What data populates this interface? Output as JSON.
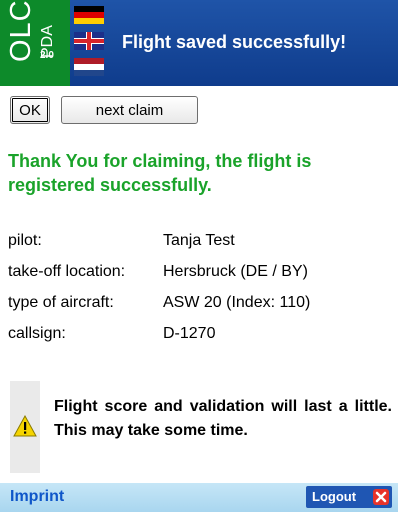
{
  "header": {
    "logo_text": "OLC",
    "logo_sub": "PDA",
    "logo_version": "2.0",
    "title": "Flight saved successfully!",
    "flags": [
      "germany-flag",
      "uk-flag",
      "netherlands-flag"
    ]
  },
  "buttons": {
    "ok_label": "OK",
    "next_claim_label": "next claim"
  },
  "message": "Thank You for claiming, the flight is registered successfully.",
  "details": [
    {
      "label": "pilot:",
      "value": "Tanja Test"
    },
    {
      "label": "take-off location:",
      "value": "Hersbruck (DE / BY)"
    },
    {
      "label": "type of aircraft:",
      "value": "ASW 20 (Index: 110)"
    },
    {
      "label": "callsign:",
      "value": "D-1270"
    }
  ],
  "notice": {
    "icon": "warning-icon",
    "text": "Flight score and validation will last a little. This may take some time."
  },
  "footer": {
    "imprint_label": "Imprint",
    "logout_label": "Logout",
    "logout_icon": "close-icon"
  },
  "colors": {
    "header_bg": "#1a4a9c",
    "logo_bg": "#0d8a2a",
    "success_text": "#1aa32a",
    "footer_bg": "#bfe2f4",
    "link": "#0f56c9",
    "logout_bg": "#1f56b3",
    "logout_icon_bg": "#e8332a"
  }
}
